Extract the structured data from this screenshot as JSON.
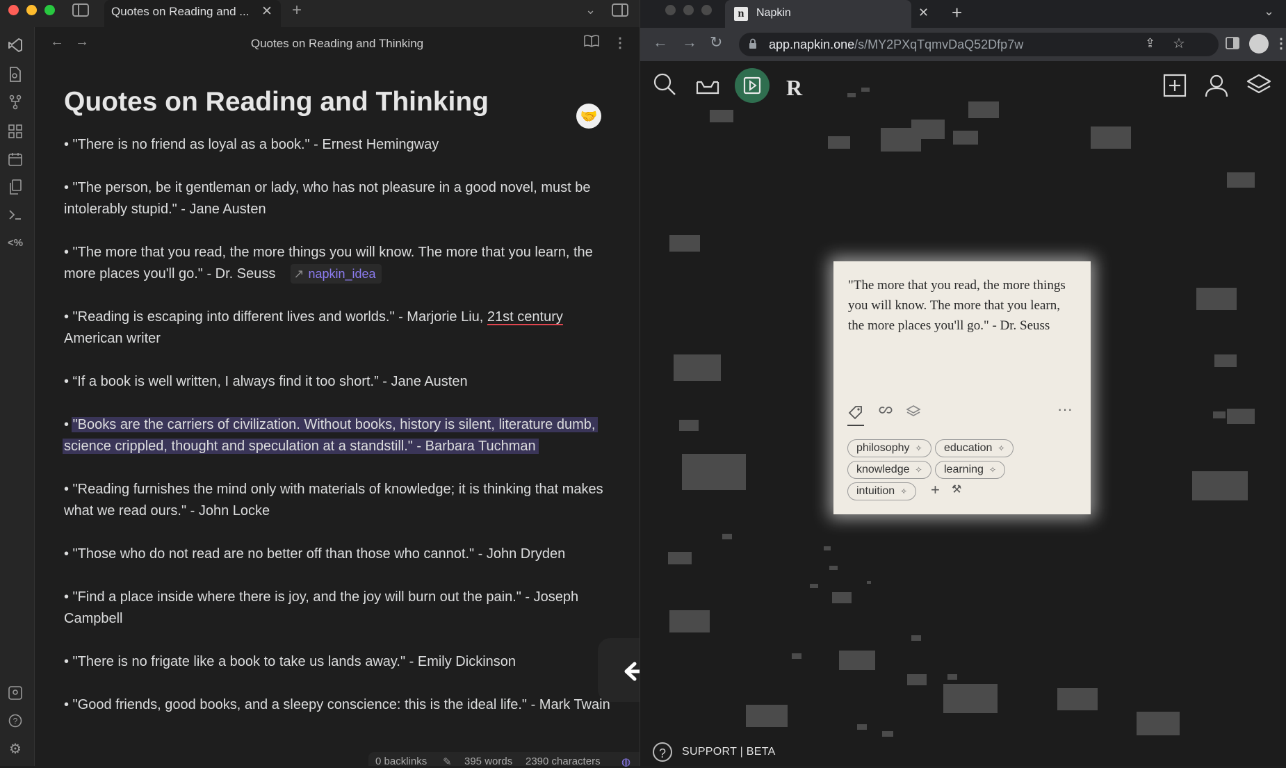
{
  "obsidian": {
    "tab_title": "Quotes on Reading and ...",
    "header_title": "Quotes on Reading and Thinking",
    "note_title": "Quotes on Reading and Thinking",
    "quotes": [
      "• \"There is no friend as loyal as a book.\" - Ernest Hemingway",
      "• \"The person, be it gentleman or lady, who has not pleasure in a good novel, must be intolerably stupid.\" - Jane Austen",
      "• \"The more that you read, the more things you will know. The more that you learn, the more places you'll go.\" - Dr. Seuss",
      "• \"Reading is escaping into different lives and worlds.\" - Marjorie Liu,",
      "• “If a book is well written, I always find it too short.” - Jane Austen",
      "\"Books are the carriers of civilization. Without books, history is silent, literature dumb, science crippled, thought and speculation at a standstill.\" - Barbara Tuchman",
      "• \"Reading furnishes the mind only with materials of knowledge; it is thinking that makes what we read ours.\" - John Locke",
      "• \"Those who do not read are no better off than those who cannot.\" - John Dryden",
      "• \"Find a place inside where there is joy, and the joy will burn out the pain.\" - Joseph Campbell",
      "• \"There is no frigate like a book to take us lands away.\" - Emily Dickinson",
      "• \"Good friends, good books, and a sleepy conscience: this is the ideal life.\" - Mark Twain"
    ],
    "bullet": "•",
    "liu_underlined": "21st century",
    "liu_suffix": "American writer",
    "link_label": "napkin_idea",
    "status": {
      "backlinks": "0 backlinks",
      "words": "395 words",
      "characters": "2390 characters"
    }
  },
  "browser": {
    "tab_title": "Napkin",
    "url_host": "app.napkin.one",
    "url_path": "/s/MY2PXqTqmvDaQ52Dfp7w",
    "favicon_letter": "n"
  },
  "napkin": {
    "card_text": "\"The more that you read, the more things you will know. The more that you learn, the more places you'll go.\" - Dr. Seuss",
    "tags": [
      "philosophy",
      "education",
      "knowledge",
      "learning",
      "intuition"
    ],
    "support_label": "SUPPORT | BETA",
    "r_logo": "R"
  },
  "colors": {
    "accent_link": "#8c7cf0",
    "highlight": "#3a3558",
    "card_bg": "#efebe3",
    "active_tool": "#2f6e4f",
    "traffic_red": "#ff5f57",
    "traffic_yellow": "#febc2e",
    "traffic_green": "#28c840"
  }
}
